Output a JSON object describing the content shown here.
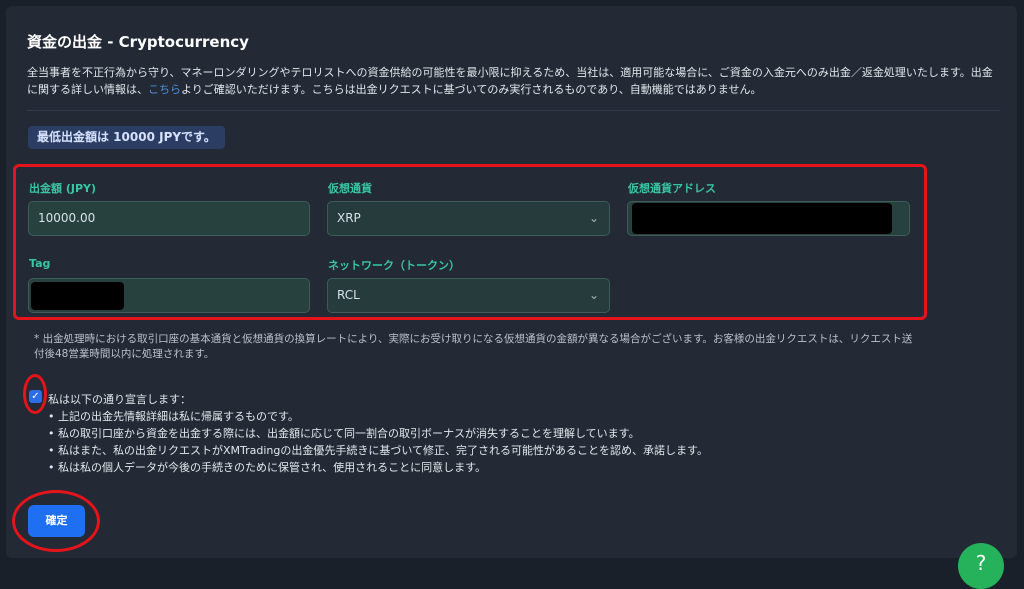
{
  "title": "資金の出金 - Cryptocurrency",
  "description": {
    "before_link": "全当事者を不正行為から守り、マネーロンダリングやテロリストへの資金供給の可能性を最小限に抑えるため、当社は、適用可能な場合に、ご資金の入金元へのみ出金／返金処理いたします。出金に関する詳しい情報は、",
    "link": "こちら",
    "after_link": "よりご確認いただけます。こちらは出金リクエストに基づいてのみ実行されるものであり、自動機能ではありません。"
  },
  "min_notice": "最低出金額は 10000 JPYです。",
  "form": {
    "amount_label": "出金額 (JPY)",
    "amount_value": "10000.00",
    "currency_label": "仮想通貨",
    "currency_value": "XRP",
    "address_label": "仮想通貨アドレス",
    "tag_label": "Tag",
    "network_label": "ネットワーク（トークン）",
    "network_value": "RCL"
  },
  "note": "* 出金処理時における取引口座の基本通貨と仮想通貨の換算レートにより、実際にお受け取りになる仮想通貨の金額が異なる場合がございます。お客様の出金リクエストは、リクエスト送付後48営業時間以内に処理されます。",
  "declaration": {
    "heading": "私は以下の通り宣言します：",
    "checked": true,
    "items": [
      "上記の出金先情報詳細は私に帰属するものです。",
      "私の取引口座から資金を出金する際には、出金額に応じて同一割合の取引ボーナスが消失することを理解しています。",
      "私はまた、私の出金リクエストがXMTradingの出金優先手続きに基づいて修正、完了される可能性があることを認め、承諾します。",
      "私は私の個人データが今後の手続きのために保管され、使用されることに同意します。"
    ]
  },
  "submit_label": "確定",
  "icons": {
    "chevron": "chevron-down-icon",
    "check": "check-icon",
    "help": "help-icon"
  },
  "colors": {
    "accent_green": "#38c6a4",
    "button_blue": "#1e6ff2",
    "highlight_red": "#e5141b",
    "help_green": "#25b25b"
  }
}
